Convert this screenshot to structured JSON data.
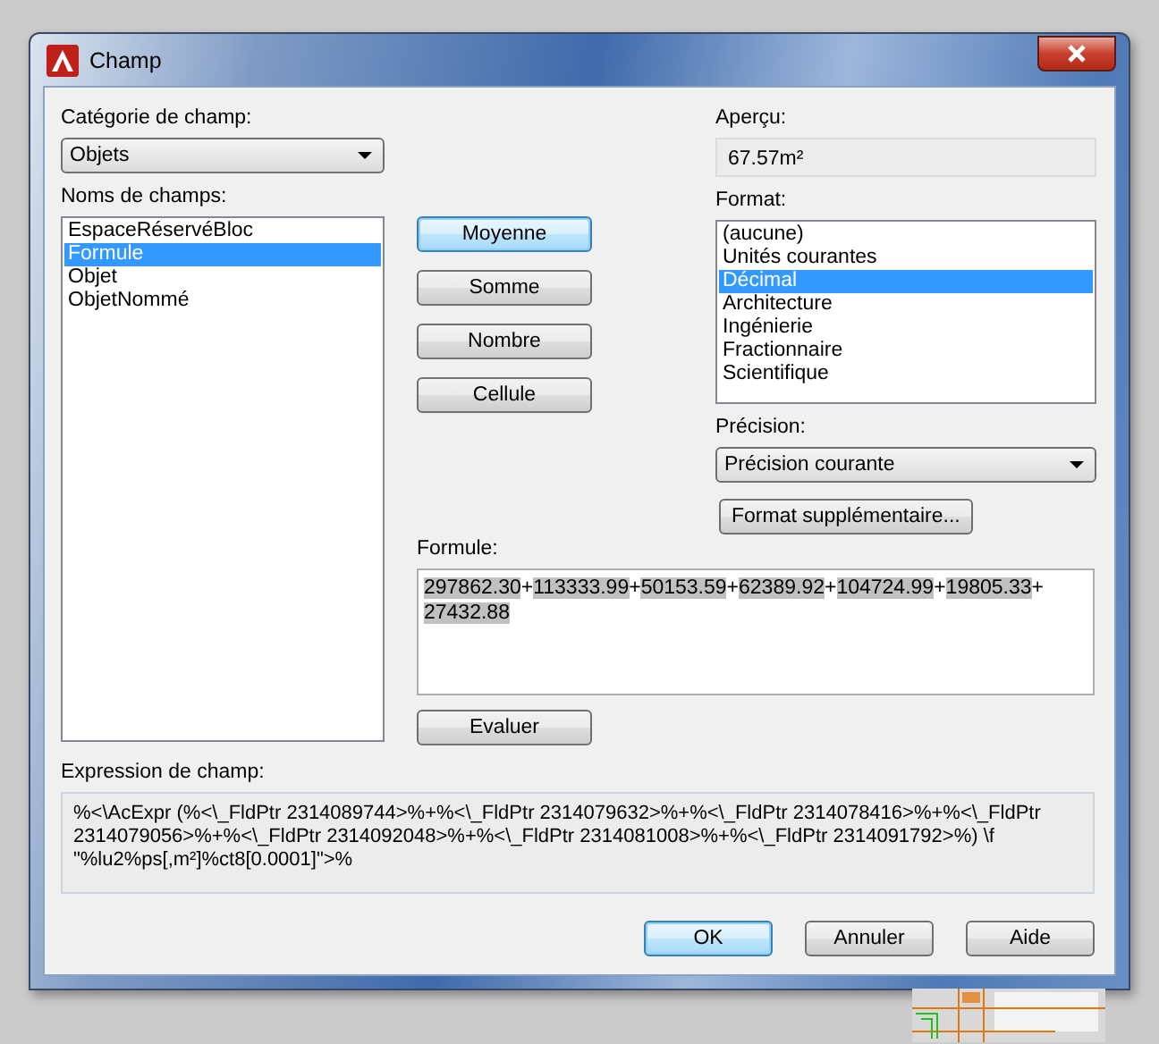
{
  "window": {
    "title": "Champ"
  },
  "field_category": {
    "label": "Catégorie de champ:",
    "value": "Objets"
  },
  "field_names": {
    "label": "Noms de champs:",
    "items": [
      {
        "label": "EspaceRéservéBloc",
        "selected": false
      },
      {
        "label": "Formule",
        "selected": true
      },
      {
        "label": "Objet",
        "selected": false
      },
      {
        "label": "ObjetNommé",
        "selected": false
      }
    ]
  },
  "function_buttons": [
    {
      "label": "Moyenne",
      "focused": true
    },
    {
      "label": "Somme",
      "focused": false
    },
    {
      "label": "Nombre",
      "focused": false
    },
    {
      "label": "Cellule",
      "focused": false
    }
  ],
  "preview": {
    "label": "Aperçu:",
    "value": "67.57m²"
  },
  "format": {
    "label": "Format:",
    "items": [
      {
        "label": "(aucune)",
        "selected": false
      },
      {
        "label": "Unités courantes",
        "selected": false
      },
      {
        "label": "Décimal",
        "selected": true
      },
      {
        "label": "Architecture",
        "selected": false
      },
      {
        "label": "Ingénierie",
        "selected": false
      },
      {
        "label": "Fractionnaire",
        "selected": false
      },
      {
        "label": "Scientifique",
        "selected": false
      }
    ]
  },
  "precision": {
    "label": "Précision:",
    "value": "Précision courante"
  },
  "additional_format_button": "Format supplémentaire...",
  "formula": {
    "label": "Formule:",
    "tokens": [
      {
        "text": "297862.30",
        "highlighted": true
      },
      {
        "text": "+",
        "highlighted": false
      },
      {
        "text": "113333.99",
        "highlighted": true
      },
      {
        "text": "+",
        "highlighted": false
      },
      {
        "text": "50153.59",
        "highlighted": true
      },
      {
        "text": "+",
        "highlighted": false
      },
      {
        "text": "62389.92",
        "highlighted": true
      },
      {
        "text": "+",
        "highlighted": false
      },
      {
        "text": "104724.99",
        "highlighted": true
      },
      {
        "text": "+",
        "highlighted": false
      },
      {
        "text": "19805.33",
        "highlighted": true
      },
      {
        "text": "+",
        "highlighted": false
      },
      {
        "text": "27432.88",
        "highlighted": true
      }
    ]
  },
  "evaluate_button": "Evaluer",
  "field_expression": {
    "label": "Expression de champ:",
    "value": "%<\\AcExpr (%<\\_FldPtr 2314089744>%+%<\\_FldPtr 2314079632>%+%<\\_FldPtr 2314078416>%+%<\\_FldPtr 2314079056>%+%<\\_FldPtr 2314092048>%+%<\\_FldPtr 2314081008>%+%<\\_FldPtr 2314091792>%) \\f \"%lu2%ps[,m²]%ct8[0.0001]\">%"
  },
  "dialog_buttons": [
    {
      "label": "OK",
      "default": true
    },
    {
      "label": "Annuler",
      "default": false
    },
    {
      "label": "Aide",
      "default": false
    }
  ]
}
